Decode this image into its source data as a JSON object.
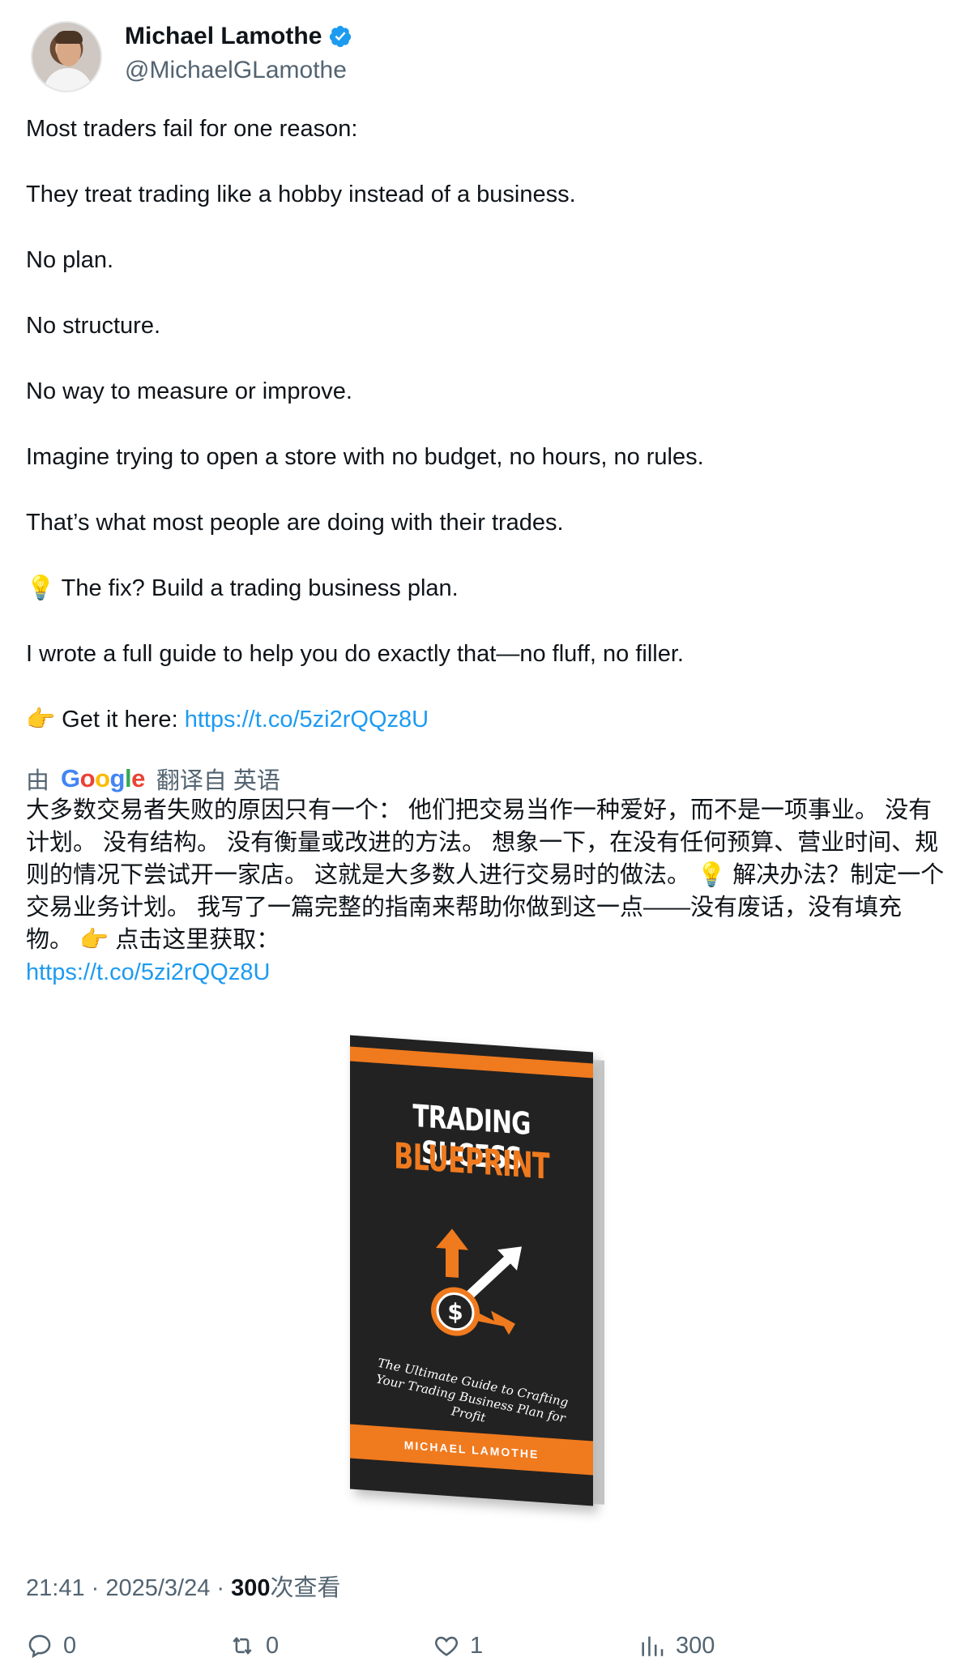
{
  "author": {
    "display_name": "Michael Lamothe",
    "handle": "@MichaelGLamothe",
    "verified_color": "#1d9bf0"
  },
  "tweet": {
    "paragraphs": [
      "Most traders fail for one reason:",
      "They treat trading like a hobby instead of a business.",
      "No plan.",
      "No structure.",
      "No way to measure or improve.",
      "Imagine trying to open a store with no budget, no hours, no rules.",
      "That’s what most people are doing with their trades.",
      "💡 The fix? Build a trading business plan.",
      "I wrote a full guide to help you do exactly that—no fluff, no filler."
    ],
    "cta_prefix": "👉 Get it here: ",
    "link": "https://t.co/5zi2rQQz8U"
  },
  "translation": {
    "by_label": "由",
    "google_letters": [
      "G",
      "o",
      "o",
      "g",
      "l",
      "e"
    ],
    "google_colors": [
      "#4285f4",
      "#ea4335",
      "#fbbc05",
      "#4285f4",
      "#34a853",
      "#ea4335"
    ],
    "from_label": "翻译自 英语",
    "text": "大多数交易者失败的原因只有一个： 他们把交易当作一种爱好，而不是一项事业。 没有计划。 没有结构。 没有衡量或改进的方法。 想象一下，在没有任何预算、营业时间、规则的情况下尝试开一家店。 这就是大多数人进行交易时的做法。 💡 解决办法？制定一个交易业务计划。 我写了一篇完整的指南来帮助你做到这一点——没有废话，没有填充物。 👉 点击这里获取：",
    "link": "https://t.co/5zi2rQQz8U"
  },
  "media": {
    "book_title_line1": "TRADING SUCESS",
    "book_title_line2": "BLUEPRINT",
    "book_subtitle": "The Ultimate Guide to Crafting Your Trading Business Plan for Profit",
    "book_author": "MICHAEL LAMOTHE",
    "accent_color": "#f07a1e"
  },
  "meta": {
    "time": "21:41",
    "separator": " · ",
    "date": "2025/3/24",
    "views_count": "300",
    "views_label": "次查看"
  },
  "actions": {
    "reply_count": "0",
    "retweet_count": "0",
    "like_count": "1",
    "views_count": "300"
  },
  "colors": {
    "text": "#0f1419",
    "secondary": "#536471",
    "link": "#1d9bf0"
  }
}
